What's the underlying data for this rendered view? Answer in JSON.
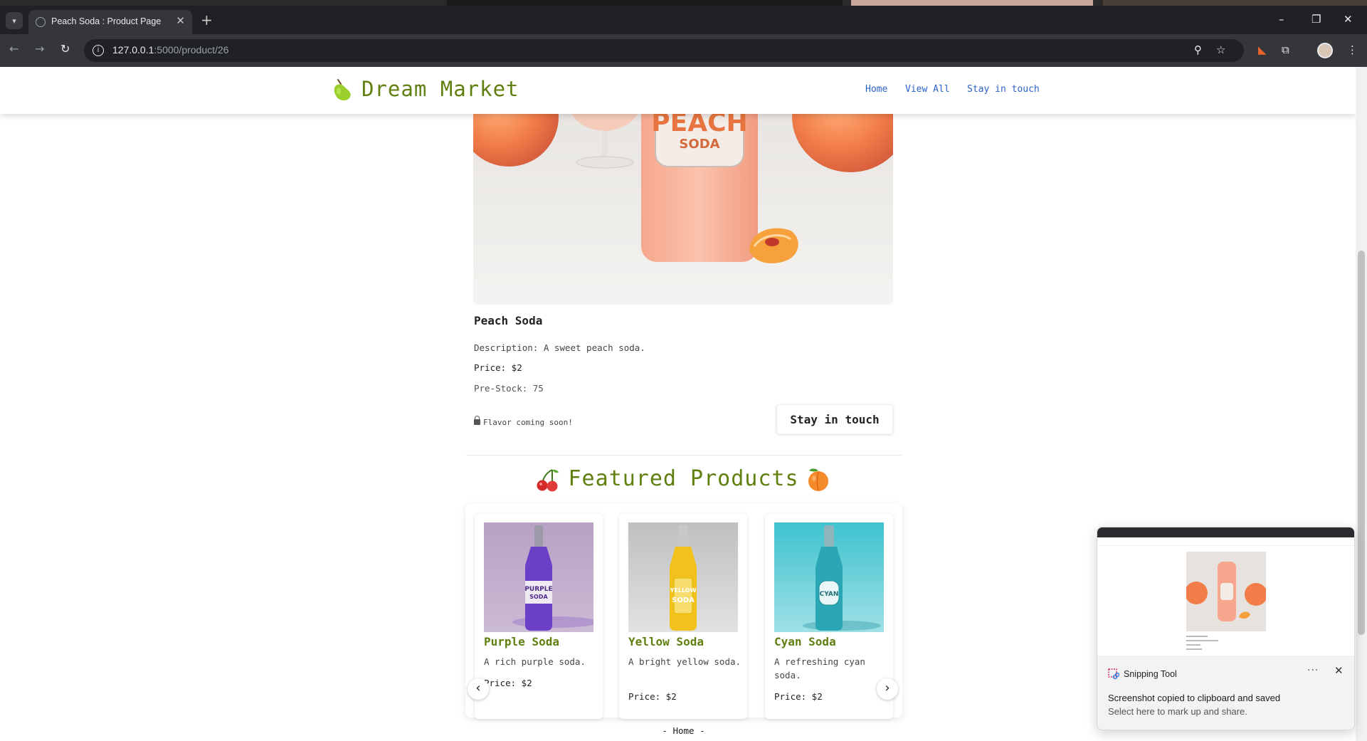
{
  "browser": {
    "tab_title": "Peach Soda : Product Page",
    "url_host": "127.0.0.1",
    "url_path": ":5000/product/26",
    "tab_list_icon": "chevron-down-icon",
    "new_tab_label": "+",
    "minimize": "–",
    "restore": "❐",
    "close": "✕",
    "back": "←",
    "forward": "→",
    "reload": "↻",
    "zoom_icon": "⚲",
    "bookmark_icon": "☆",
    "menu_icon": "⋮"
  },
  "site": {
    "brand": "Dream Market",
    "nav": [
      "Home",
      "View All",
      "Stay in touch"
    ],
    "accent": "#5f7f0e",
    "link_color": "#2a62c9"
  },
  "product": {
    "name": "Peach Soda",
    "description": "Description: A sweet peach soda.",
    "price": "Price: $2",
    "pre_stock": "Pre-Stock: 75",
    "coming_soon": "Flavor coming soon!",
    "cta": "Stay in touch",
    "label_top": "PEACH",
    "label_bottom": "SODA"
  },
  "featured": {
    "title": "Featured Products",
    "prev": "‹",
    "next": "›",
    "items": [
      {
        "name": "Purple Soda",
        "description": "A rich purple soda.",
        "price": "Price: $2",
        "label_top": "PURPLE",
        "label_bottom": "SODA",
        "color": "#6b3fc7"
      },
      {
        "name": "Yellow Soda",
        "description": "A bright yellow soda.",
        "price": "Price: $2",
        "label_top": "YELLOW",
        "label_bottom": "SODA",
        "color": "#f1c21b"
      },
      {
        "name": "Cyan Soda",
        "description": "A refreshing cyan soda.",
        "price": "Price: $2",
        "label_top": "CYAN",
        "label_bottom": "",
        "color": "#2aa6b4"
      }
    ]
  },
  "footer": {
    "home": "- Home -"
  },
  "toast": {
    "app": "Snipping Tool",
    "message": "Screenshot copied to clipboard and saved",
    "sub": "Select here to mark up and share.",
    "dots": "···",
    "close": "✕"
  }
}
